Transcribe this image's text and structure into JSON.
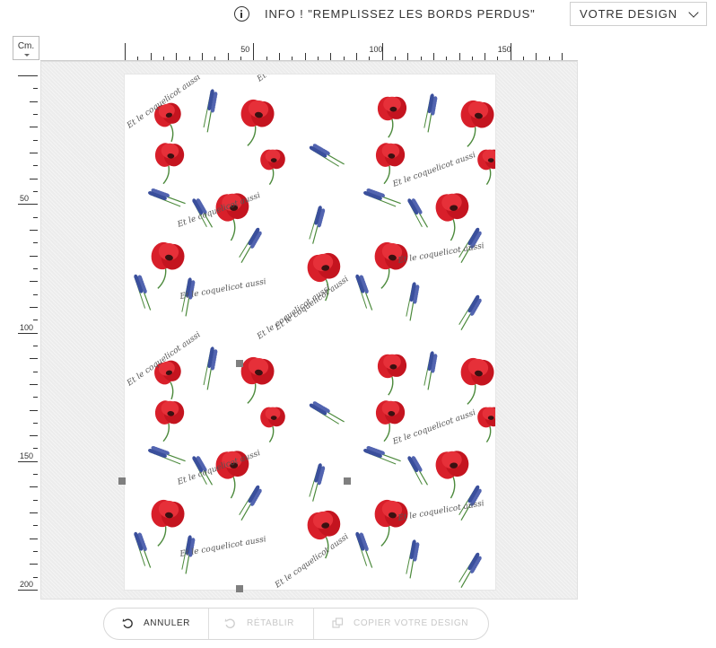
{
  "header": {
    "info_text": "INFO ! \"REMPLISSEZ LES BORDS PERDUS\"",
    "design_dropdown": "VOTRE DESIGN"
  },
  "unit_selector": "Cm.",
  "ruler": {
    "horizontal_labels": [
      "50",
      "100",
      "150"
    ],
    "vertical_labels": [
      "50",
      "100",
      "150",
      "200"
    ]
  },
  "canvas": {
    "pattern_motifs": [
      "red-poppy",
      "lavender-sprig"
    ],
    "pattern_text": "Et le coquelicot aussi"
  },
  "toolbar": {
    "undo_label": "ANNULER",
    "redo_label": "RÉTABLIR",
    "copy_label": "COPIER VOTRE DESIGN"
  },
  "colors": {
    "poppy": "#d81f2a",
    "lavender": "#3a4f9c",
    "stem": "#4c8a3c",
    "handle": "#7f7f7f"
  }
}
